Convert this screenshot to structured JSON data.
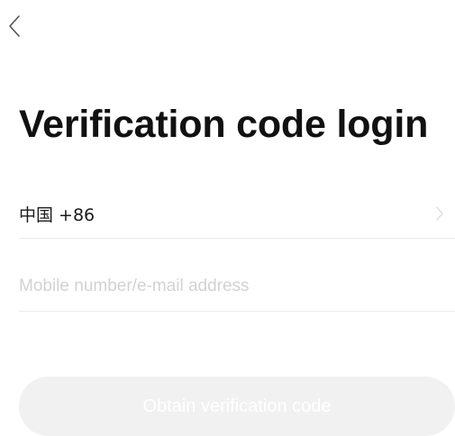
{
  "header": {
    "back_icon": "chevron-left-icon"
  },
  "main": {
    "title": "Verification code login",
    "country_code": {
      "label": "中国 +86",
      "icon": "chevron-right-icon"
    },
    "account_input": {
      "value": "",
      "placeholder": "Mobile number/e-mail address"
    },
    "obtain_button": {
      "label": "Obtain verification code",
      "enabled": false
    }
  },
  "colors": {
    "background": "#ffffff",
    "text_primary": "#111111",
    "placeholder": "#d2d2d2",
    "divider": "#ececec",
    "button_disabled_bg": "#f1f1f1",
    "button_text": "#ffffff"
  }
}
